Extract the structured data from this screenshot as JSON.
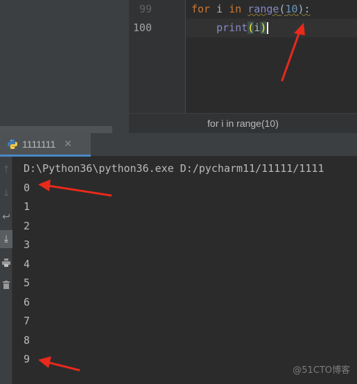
{
  "editor": {
    "line_numbers": [
      "99",
      "100"
    ],
    "code_line_1": {
      "kw_for": "for",
      "var": " i ",
      "kw_in": "in",
      "space": " ",
      "func": "range",
      "open": "(",
      "num": "10",
      "close": "):"
    },
    "code_line_2": {
      "indent": "    ",
      "func": "print",
      "open": "(",
      "arg": "i",
      "close": ")"
    },
    "breadcrumb": "for i in range(10)"
  },
  "run": {
    "tab_label": "1111111",
    "tab_icon": "python-icon",
    "close_glyph": "✕",
    "toolbar_icons": [
      "arrow-up-icon",
      "arrow-down-icon",
      "soft-wrap-icon",
      "scroll-to-end-icon",
      "print-icon",
      "trash-icon"
    ],
    "command": "D:\\Python36\\python36.exe D:/pycharm11/11111/1111",
    "output": [
      "0",
      "1",
      "2",
      "3",
      "4",
      "5",
      "6",
      "7",
      "8",
      "9"
    ]
  },
  "watermark": "@51CTO博客",
  "colors": {
    "annotation_arrow": "#e8291c",
    "keyword": "#cc7832",
    "number": "#6897bb",
    "builtin": "#8888c6"
  }
}
